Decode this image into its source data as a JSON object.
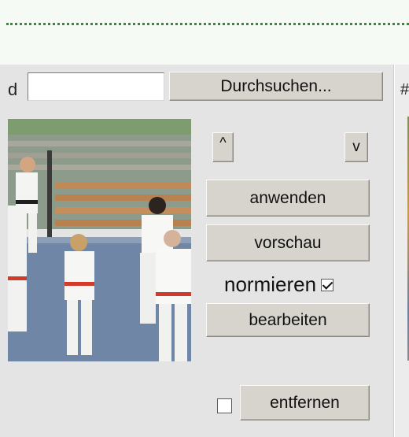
{
  "upload": {
    "field_label_fragment": "d",
    "file_input_value": "",
    "browse_label": "Durchsuchen..."
  },
  "controls": {
    "up_label": "^",
    "down_label": "v",
    "apply_label": "anwenden",
    "preview_label": "vorschau",
    "normalize_label": "normieren",
    "normalize_checked": true,
    "edit_label": "bearbeiten",
    "remove_label": "entfernen",
    "remove_checked": false
  },
  "side_panel": {
    "hash_label": "#"
  },
  "colors": {
    "dotted_rule": "#2f8f2f",
    "panel_bg": "#e4e4e4",
    "button_face": "#d7d3cd"
  },
  "image": {
    "subject": "karate training group photo",
    "icon": "photo-thumbnail"
  }
}
